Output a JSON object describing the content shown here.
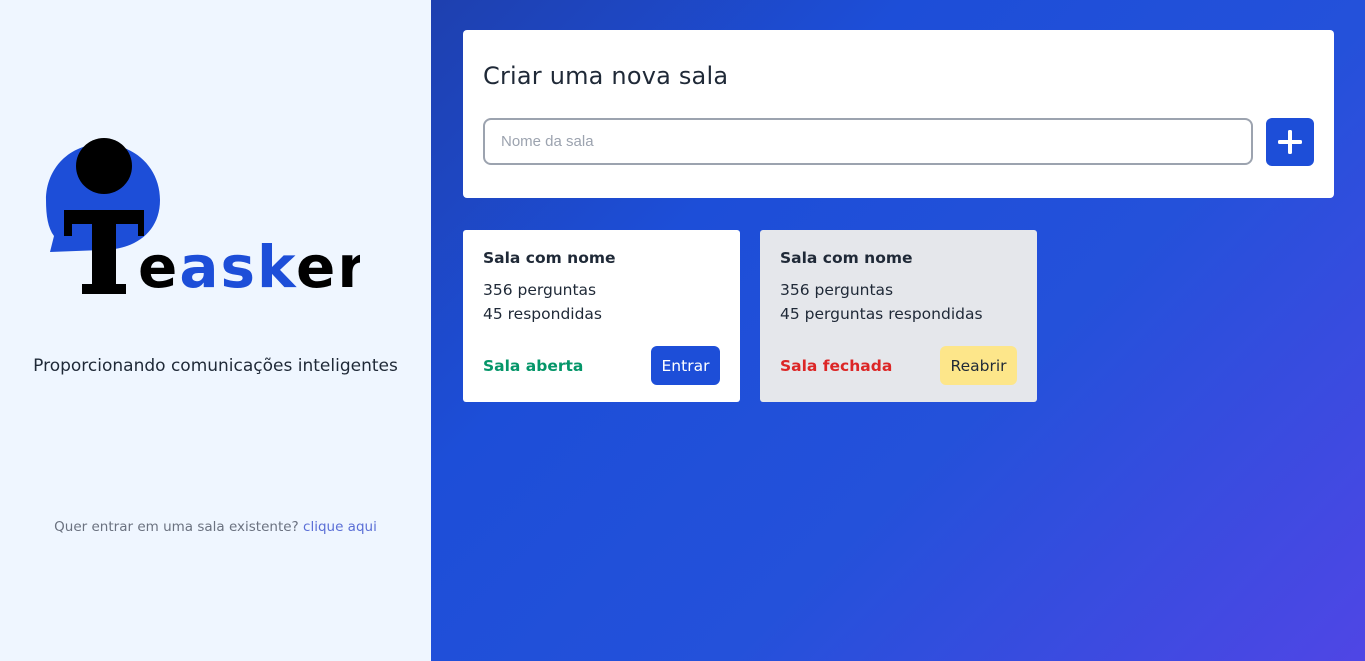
{
  "brand": {
    "logo_text_prefix": "e",
    "logo_text_accent": "ask",
    "logo_text_suffix": "er",
    "colors": {
      "accent": "#1d4ed8",
      "dark": "#000000"
    }
  },
  "sidebar": {
    "tagline": "Proporcionando comunicações inteligentes",
    "join_prompt": "Quer entrar em uma sala existente?",
    "join_link": "clique aqui"
  },
  "create_room": {
    "title": "Criar uma nova sala",
    "input_placeholder": "Nome da sala",
    "input_value": "",
    "add_icon": "plus-icon"
  },
  "rooms": [
    {
      "name": "Sala com nome",
      "questions": "356 perguntas",
      "answered": "45 respondidas",
      "status": "Sala aberta",
      "status_color": "#059669",
      "action": "Entrar"
    },
    {
      "name": "Sala com nome",
      "questions": "356 perguntas",
      "answered": "45 perguntas respondidas",
      "status": "Sala fechada",
      "status_color": "#dc2626",
      "action": "Reabrir"
    }
  ]
}
